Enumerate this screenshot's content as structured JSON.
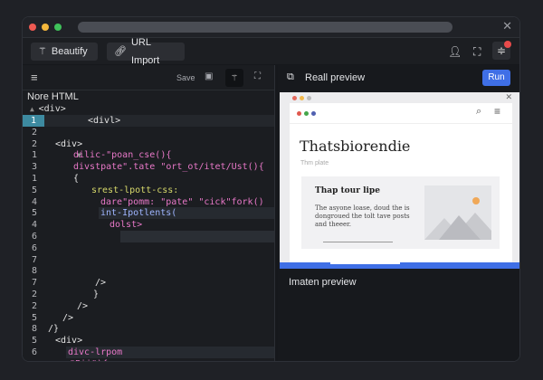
{
  "window": {
    "close_icon": "close-icon",
    "traffic_colors": [
      "#ee5a52",
      "#f5b83c",
      "#3fc25a"
    ]
  },
  "toolbar": {
    "beautify_label": "Beautify",
    "url_import_label": "URL Import",
    "icons": [
      "user-icon",
      "fullscreen-icon",
      "settings-sliders-icon"
    ],
    "notification_color": "#e94b4b"
  },
  "editor": {
    "save_label": "Save",
    "file_title": "Nore HTML",
    "root_tag": "<div>",
    "lines": [
      {
        "n": "1",
        "t": "<divl>",
        "active": true
      },
      {
        "n": "2",
        "t": ""
      },
      {
        "n": "2",
        "t": "<div>"
      },
      {
        "n": "1",
        "t": "dilic-\"poan_cse(){",
        "fold": true
      },
      {
        "n": "3",
        "t": "divstpate\".tate \"ort_ot/itet/Ust(){"
      },
      {
        "n": "1",
        "t": "{"
      },
      {
        "n": "5",
        "t": "srest-lpott-css:"
      },
      {
        "n": "4",
        "t": "dare\"pomm: \"pate\" \"cick\"fork()"
      },
      {
        "n": "5",
        "t": "int-Ipotlents(",
        "hl": true
      },
      {
        "n": "4",
        "t": "dolst>"
      },
      {
        "n": "6",
        "t": "",
        "hl2": true
      },
      {
        "n": "6",
        "t": ""
      },
      {
        "n": "7",
        "t": ""
      },
      {
        "n": "8",
        "t": ""
      },
      {
        "n": "7",
        "t": "/>"
      },
      {
        "n": "2",
        "t": "}"
      },
      {
        "n": "2",
        "t": "/>"
      },
      {
        "n": "5",
        "t": "/>"
      },
      {
        "n": "8",
        "t": "/}"
      },
      {
        "n": "5",
        "t": "<div>"
      },
      {
        "n": "6",
        "t": "divc-lrpom",
        "hl": true
      },
      {
        "n": "",
        "t": "\"Pii\"){"
      }
    ]
  },
  "preview": {
    "title": "Reall preview",
    "run_label": "Run",
    "heading": "Thatsbiorendie",
    "subheading": "Thm plate",
    "card_title": "Thap tour lipe",
    "card_text": "The asyone loase, doud the is dongroued the tolt tave posts and theeer.",
    "bottom_title": "Imaten preview",
    "accent": "#3f6fe6",
    "sun_color": "#f0a858"
  }
}
